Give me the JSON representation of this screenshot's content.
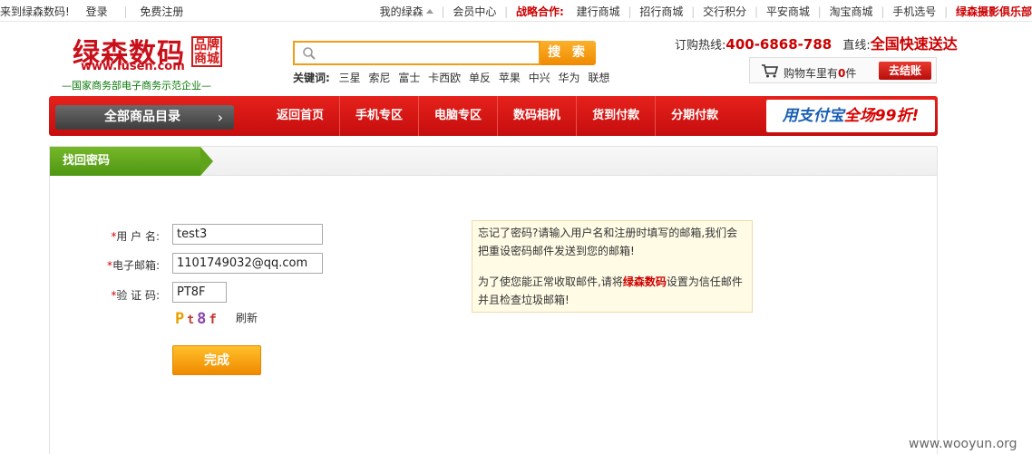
{
  "topbar": {
    "welcome": "来到绿森数码!",
    "login": "登录",
    "register": "免费注册",
    "my_account": "我的绿森",
    "member_center": "会员中心",
    "partners_label": "战略合作:",
    "partners": [
      "建行商城",
      "招行商城",
      "交行积分",
      "平安商城",
      "淘宝商城",
      "手机选号"
    ],
    "photo_club": "绿森摄影俱乐部"
  },
  "logo": {
    "name": "绿森数码",
    "badge": "品牌商城",
    "url": "www.lusen.com",
    "slogan": "—国家商务部电子商务示范企业—"
  },
  "search": {
    "value": "",
    "button": "搜 索",
    "keywords_label": "关键词:",
    "keywords": [
      "三星",
      "索尼",
      "富士",
      "卡西欧",
      "单反",
      "苹果",
      "中兴",
      "华为",
      "联想"
    ]
  },
  "hotline": {
    "label": "订购热线:",
    "number": "400-6868-788",
    "direct_label": "直线:",
    "direct_text": "全国快速送达"
  },
  "cart": {
    "prefix": "购物车里有",
    "count": "0",
    "suffix": "件",
    "checkout": "去结账"
  },
  "nav": {
    "all_products": "全部商品目录",
    "items": [
      "返回首页",
      "手机专区",
      "电脑专区",
      "数码相机",
      "货到付款",
      "分期付款"
    ],
    "promo_blue": "用支付宝",
    "promo_red": "全场99折!"
  },
  "panel": {
    "title": "找回密码",
    "username_label": "用 户 名:",
    "username_value": "test3",
    "email_label": "电子邮箱:",
    "email_value": "1101749032@qq.com",
    "captcha_label": "验 证 码:",
    "captcha_value": "PT8F",
    "captcha_image_text": "Pt8f",
    "refresh": "刷新",
    "submit": "完成",
    "tip_line1": "忘记了密码?请输入用户名和注册时填写的邮箱,我们会把重设密码邮件发送到您的邮箱!",
    "tip_line2_pre": "为了使您能正常收取邮件,请将",
    "tip_brand": "绿森数码",
    "tip_line2_post": "设置为信任邮件并且检查垃圾邮箱!"
  },
  "watermark": "www.wooyun.org",
  "colors": {
    "brand_red": "#c8101a",
    "nav_red": "#d81616",
    "tab_green": "#5ea31a",
    "search_orange": "#f19d16",
    "submit_orange": "#f8a010"
  }
}
